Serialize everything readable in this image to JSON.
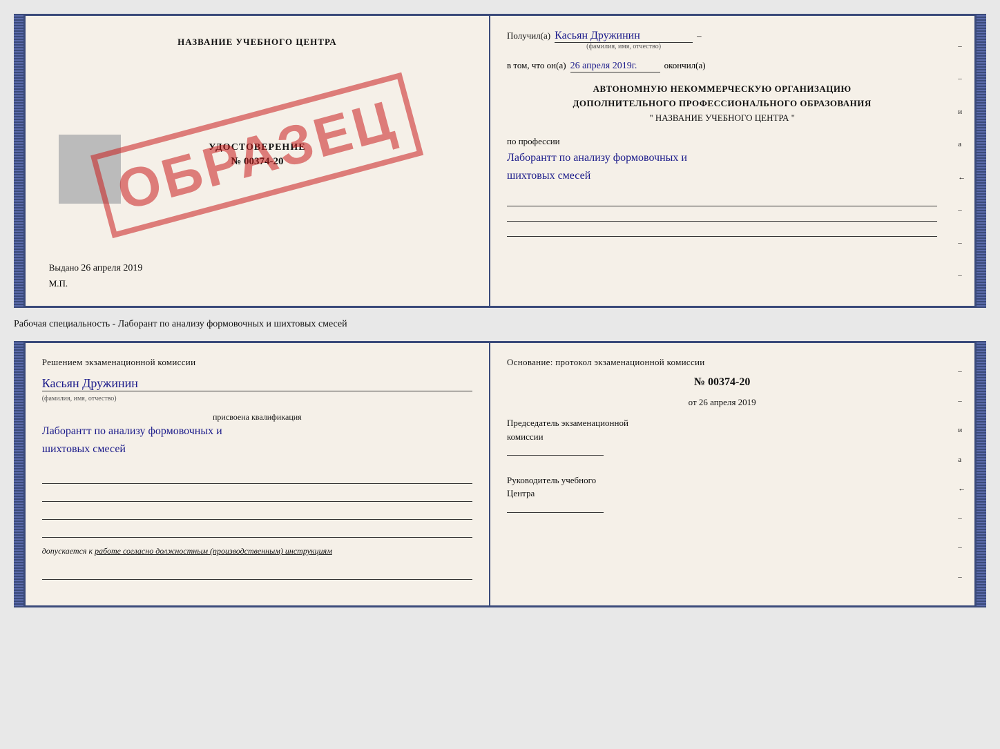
{
  "top_doc": {
    "left": {
      "title": "НАЗВАНИЕ УЧЕБНОГО ЦЕНТРА",
      "stamp_text": "ОБРАЗЕЦ",
      "udostoverenie_label": "УДОСТОВЕРЕНИЕ",
      "udostoverenie_number": "№ 00374-20",
      "vydano_label": "Выдано",
      "vydano_date": "26 апреля 2019",
      "mp_label": "М.П."
    },
    "right": {
      "poluchil_label": "Получил(а)",
      "poluchil_name": "Касьян Дружинин",
      "poluchil_subtitle": "(фамилия, имя, отчество)",
      "dash": "–",
      "vtom_label": "в том, что он(а)",
      "vtom_date": "26 апреля 2019г.",
      "okonchil_label": "окончил(а)",
      "org_line1": "АВТОНОМНУЮ НЕКОММЕРЧЕСКУЮ ОРГАНИЗАЦИЮ",
      "org_line2": "ДОПОЛНИТЕЛЬНОГО ПРОФЕССИОНАЛЬНОГО ОБРАЗОВАНИЯ",
      "org_line3": "\"  НАЗВАНИЕ УЧЕБНОГО ЦЕНТРА  \"",
      "po_professii_label": "по профессии",
      "profession_name": "Лаборантт по анализу формовочных и",
      "profession_name2": "шихтовых смесей"
    }
  },
  "middle": {
    "text": "Рабочая специальность - Лаборант по анализу формовочных и шихтовых смесей"
  },
  "bottom_doc": {
    "left": {
      "resheniem_label": "Решением  экзаменационной  комиссии",
      "name": "Касьян Дружинин",
      "name_subtitle": "(фамилия, имя, отчество)",
      "prisvoena_label": "присвоена квалификация",
      "qualification": "Лаборантт по анализу формовочных и",
      "qualification2": "шихтовых смесей",
      "dopuskaetsya_prefix": "допускается к",
      "dopuskaetsya_text": "работе согласно должностным (производственным) инструкциям"
    },
    "right": {
      "osnovanie_label": "Основание: протокол экзаменационной  комиссии",
      "protocol_number": "№  00374-20",
      "ot_label": "от",
      "ot_date": "26 апреля 2019",
      "predsedatel_line1": "Председатель экзаменационной",
      "predsedatel_line2": "комиссии",
      "rukovoditel_line1": "Руководитель учебного",
      "rukovoditel_line2": "Центра"
    }
  },
  "side_marks": {
    "items": [
      "–",
      "–",
      "и",
      "а",
      "←",
      "–",
      "–",
      "–"
    ]
  }
}
